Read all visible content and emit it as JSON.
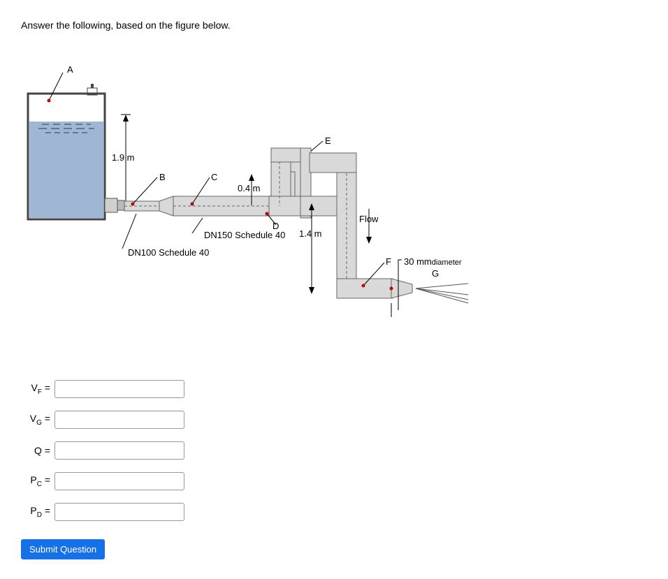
{
  "question": "Answer the following, based on the figure below.",
  "figure": {
    "labels": {
      "A": "A",
      "B": "B",
      "C": "C",
      "D": "D",
      "E": "E",
      "F": "F",
      "G": "G",
      "h_19": "1.9 m",
      "h_04": "0.4 m",
      "h_14": "1.4 m",
      "flow": "Flow",
      "dn150": "DN150 Schedule 40",
      "dn100": "DN100 Schedule 40",
      "diameter": "30 mm",
      "diameter_sub": "diameter"
    }
  },
  "answers": {
    "vf_label": "V",
    "vf_sub": "F",
    "vg_label": "V",
    "vg_sub": "G",
    "q_label": "Q",
    "pc_label": "P",
    "pc_sub": "C",
    "pd_label": "P",
    "pd_sub": "D",
    "eq": "="
  },
  "submit_label": "Submit Question"
}
